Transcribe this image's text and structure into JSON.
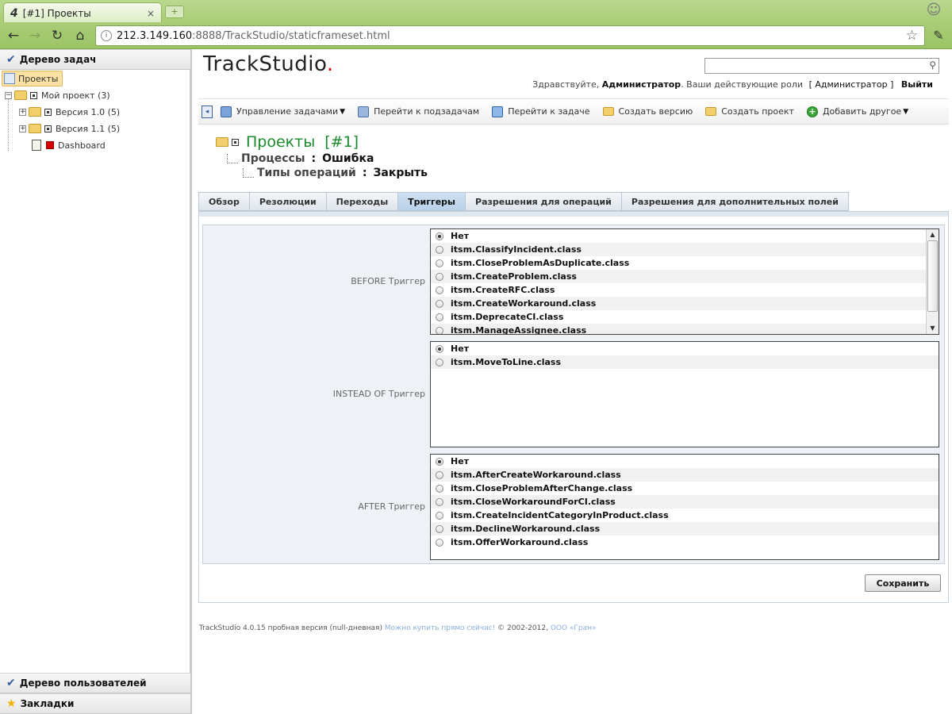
{
  "browser": {
    "tab_title": "[#1] Проекты",
    "tab_favicon": "4",
    "tab_close": "×",
    "new_tab": "+",
    "url_host": "212.3.149.160",
    "url_path": ":8888/TrackStudio/staticframeset.html",
    "icons": {
      "back": "arrow-left-icon",
      "forward": "arrow-right-icon",
      "reload": "reload-icon",
      "home": "home-icon",
      "bookmark": "star-icon",
      "menu": "wrench-icon"
    }
  },
  "sidebar": {
    "task_tree_title": "Дерево задач",
    "user_tree_title": "Дерево пользователей",
    "bookmarks_title": "Закладки",
    "tree": {
      "root": "Проекты",
      "my_project": "Мой проект (3)",
      "version_10": "Версия 1.0 (5)",
      "version_11": "Версия 1.1 (5)",
      "dashboard": "Dashboard"
    }
  },
  "header": {
    "logo_text": "TrackStudio",
    "logo_dot": ".",
    "greeting_prefix": "Здравствуйте,",
    "user_name": "Администратор",
    "roles_prefix": ". Ваши действующие роли",
    "roles_value": "[ Администратор ]",
    "logout": "Выйти"
  },
  "toolbar": {
    "manage_tasks": "Управление задачами",
    "go_subtasks": "Перейти к подзадачам",
    "go_task": "Перейти к задаче",
    "create_version": "Создать версию",
    "create_project": "Создать проект",
    "add_other": "Добавить другое"
  },
  "task": {
    "title": "Проекты",
    "number": "[#1]",
    "processes_label": "Процессы",
    "processes_value": "Ошибка",
    "optypes_label": "Типы операций",
    "optypes_value": "Закрыть",
    "separator": ":"
  },
  "tabs": [
    {
      "label": "Обзор",
      "active": false
    },
    {
      "label": "Резолюции",
      "active": false
    },
    {
      "label": "Переходы",
      "active": false
    },
    {
      "label": "Триггеры",
      "active": true
    },
    {
      "label": "Разрешения для операций",
      "active": false
    },
    {
      "label": "Разрешения для дополнительных полей",
      "active": false
    }
  ],
  "triggers": {
    "before": {
      "label": "BEFORE Триггер",
      "options": [
        "Нет",
        "itsm.ClassifyIncident.class",
        "itsm.CloseProblemAsDuplicate.class",
        "itsm.CreateProblem.class",
        "itsm.CreateRFC.class",
        "itsm.CreateWorkaround.class",
        "itsm.DeprecateCI.class",
        "itsm.ManageAssignee.class"
      ],
      "selected": 0
    },
    "instead": {
      "label": "INSTEAD OF Триггер",
      "options": [
        "Нет",
        "itsm.MoveToLine.class"
      ],
      "selected": 0
    },
    "after": {
      "label": "AFTER Триггер",
      "options": [
        "Нет",
        "itsm.AfterCreateWorkaround.class",
        "itsm.CloseProblemAfterChange.class",
        "itsm.CloseWorkaroundForCI.class",
        "itsm.CreateIncidentCategoryInProduct.class",
        "itsm.DeclineWorkaround.class",
        "itsm.OfferWorkaround.class"
      ],
      "selected": 0
    }
  },
  "save_label": "Сохранить",
  "footer": {
    "version_text": "TrackStudio 4.0.15 пробная версия (null-дневная)",
    "buy_link": "Можно купить прямо сейчас!",
    "copyright": "© 2002-2012,",
    "company_link": "ООО «Гран»"
  }
}
